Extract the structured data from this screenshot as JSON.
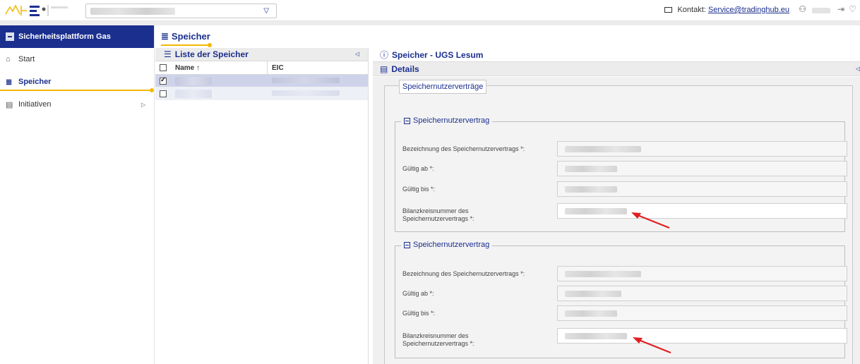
{
  "header": {
    "contact_label": "Kontakt:",
    "contact_email": "Service@tradinghub.eu",
    "colors": {
      "brand": "#1b2f8f",
      "accent": "#f2b800",
      "arrow": "#e02020"
    }
  },
  "sidebar": {
    "title": "Sicherheitsplattform Gas",
    "items": [
      {
        "label": "Start",
        "icon": "home-icon"
      },
      {
        "label": "Speicher",
        "icon": "database-icon",
        "active": true
      },
      {
        "label": "Initiativen",
        "icon": "table-icon"
      }
    ]
  },
  "main": {
    "title": "Speicher"
  },
  "list": {
    "title": "Liste der Speicher",
    "columns": {
      "name": "Name ↑",
      "eic": "EIC"
    },
    "rows": [
      {
        "checked": true
      },
      {
        "checked": false
      }
    ]
  },
  "detail": {
    "title": "Speicher - UGS Lesum",
    "details_label": "Details",
    "section_title": "Speichernutzerverträge",
    "contracts": [
      {
        "title": "Speichernutzervertrag",
        "fields": [
          {
            "label": "Bezeichnung des Speichernutzervertrags *:"
          },
          {
            "label": "Gültig ab *:"
          },
          {
            "label": "Gültig bis *:"
          },
          {
            "label_line1": "Bilanzkreisnummer des",
            "label_line2": "Speichernutzervertrags *:"
          }
        ]
      },
      {
        "title": "Speichernutzervertrag",
        "fields": [
          {
            "label": "Bezeichnung des Speichernutzervertrags *:"
          },
          {
            "label": "Gültig ab *:"
          },
          {
            "label": "Gültig bis *:"
          },
          {
            "label_line1": "Bilanzkreisnummer des",
            "label_line2": "Speichernutzervertrags *:"
          }
        ]
      }
    ]
  }
}
